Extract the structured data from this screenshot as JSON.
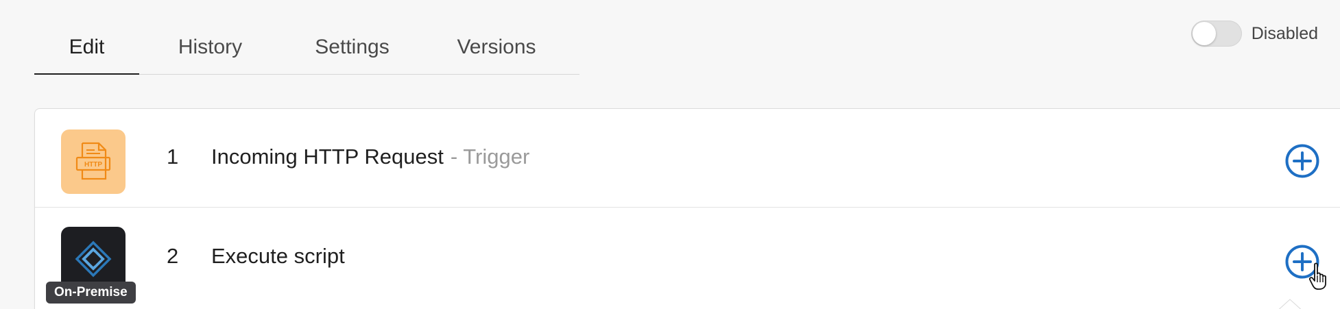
{
  "tabs": [
    {
      "label": "Edit",
      "active": true
    },
    {
      "label": "History",
      "active": false
    },
    {
      "label": "Settings",
      "active": false
    },
    {
      "label": "Versions",
      "active": false
    }
  ],
  "toggle": {
    "label": "Disabled",
    "enabled": false
  },
  "steps": [
    {
      "number": "1",
      "title": "Incoming HTTP Request",
      "subtitle": "- Trigger",
      "icon": "http-request-icon",
      "icon_text": "HTTP",
      "icon_bg": "#fbc98b"
    },
    {
      "number": "2",
      "title": "Execute script",
      "icon": "filemaker-icon",
      "icon_bg": "#1d1e22",
      "badge": "On-Premise"
    }
  ],
  "colors": {
    "accent": "#1e6fc4",
    "http_icon_stroke": "#f08a16"
  }
}
